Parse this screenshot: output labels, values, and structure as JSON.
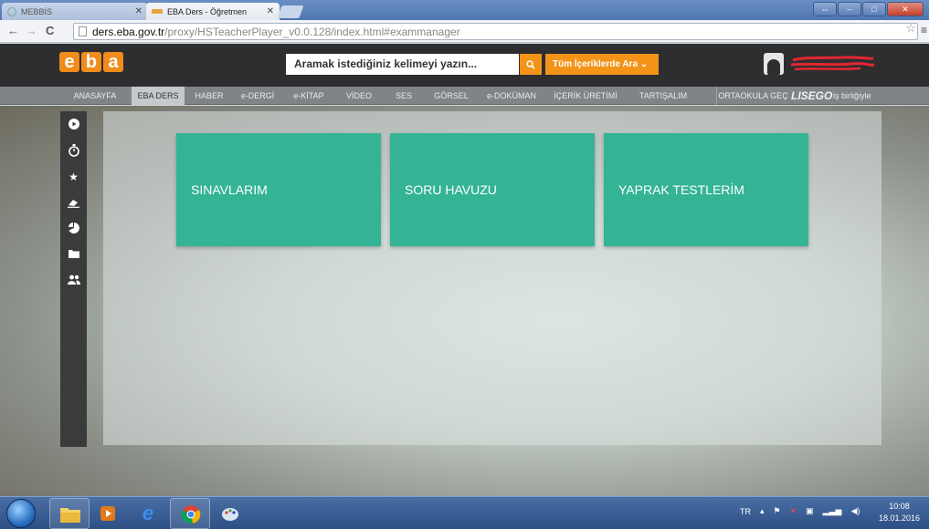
{
  "browser": {
    "tabs": [
      {
        "label": "MEBBİS",
        "active": false
      },
      {
        "label": "EBA Ders - Öğretmen",
        "active": true
      }
    ],
    "url_host": "ders.eba.gov.tr",
    "url_path": "/proxy/HSTeacherPlayer_v0.0.128/index.html#exammanager"
  },
  "header": {
    "logo_letters": [
      "e",
      "b",
      "a"
    ],
    "search_placeholder": "Aramak istediğiniz kelimeyi yazın...",
    "category_button": "Tüm İçeriklerde Ara ⌄"
  },
  "nav": {
    "items": [
      "ANASAYFA",
      "EBA DERS",
      "HABER",
      "e-DERGİ",
      "e-KİTAP",
      "VİDEO",
      "SES",
      "GÖRSEL",
      "e-DOKÜMAN",
      "İÇERİK ÜRETİMİ",
      "TARTIŞALIM",
      "ORTAOKULA GEÇ"
    ],
    "active": "EBA DERS",
    "partner_logo": "LISEGO",
    "partner_text": "iş birliğiyle"
  },
  "sidebar_icons": [
    "play-icon",
    "stopwatch-icon",
    "star-icon",
    "eraser-icon",
    "pie-chart-icon",
    "folder-icon",
    "users-icon"
  ],
  "tiles": [
    "SINAVLARIM",
    "SORU HAVUZU",
    "YAPRAK TESTLERİM"
  ],
  "colors": {
    "accent_orange": "#f39419",
    "tile_green": "#34b494",
    "header_dark": "#2e2e30"
  },
  "taskbar": {
    "tray_lang": "TR",
    "time": "10:08",
    "date": "18.01.2016"
  }
}
